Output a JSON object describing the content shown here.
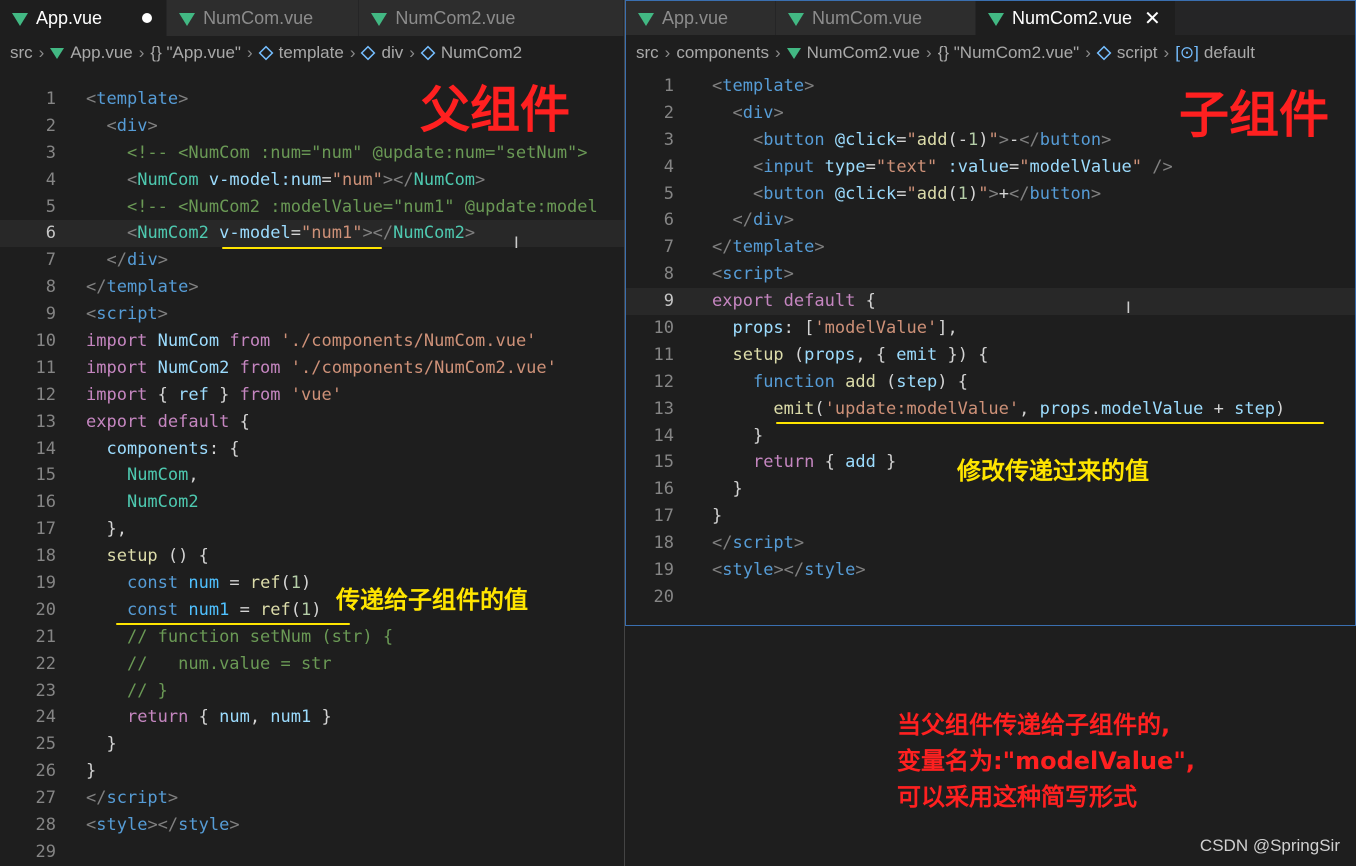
{
  "left": {
    "tabs": [
      {
        "label": "App.vue",
        "active": true,
        "modified": true
      },
      {
        "label": "NumCom.vue",
        "active": false
      },
      {
        "label": "NumCom2.vue",
        "active": false
      }
    ],
    "breadcrumb": [
      "src",
      "App.vue",
      "{} \"App.vue\"",
      "template",
      "div",
      "NumCom2"
    ],
    "heading": "父组件",
    "annotation": "传递给子组件的值",
    "lines": [
      {
        "n": "1",
        "segs": [
          [
            "t-tag",
            "<"
          ],
          [
            "t-name",
            "template"
          ],
          [
            "t-tag",
            ">"
          ]
        ]
      },
      {
        "n": "2",
        "segs": [
          [
            "t-p",
            "  "
          ],
          [
            "t-tag",
            "<"
          ],
          [
            "t-name",
            "div"
          ],
          [
            "t-tag",
            ">"
          ]
        ]
      },
      {
        "n": "3",
        "segs": [
          [
            "t-p",
            "    "
          ],
          [
            "t-cmt",
            "<!-- <NumCom :num=\"num\" @update:num=\"setNum\">"
          ]
        ]
      },
      {
        "n": "4",
        "segs": [
          [
            "t-p",
            "    "
          ],
          [
            "t-tag",
            "<"
          ],
          [
            "t-comp",
            "NumCom"
          ],
          [
            "t-p",
            " "
          ],
          [
            "t-attr",
            "v-model:num"
          ],
          [
            "t-p",
            "="
          ],
          [
            "t-str",
            "\"num\""
          ],
          [
            "t-tag",
            "></"
          ],
          [
            "t-comp",
            "NumCom"
          ],
          [
            "t-tag",
            ">"
          ]
        ]
      },
      {
        "n": "5",
        "segs": [
          [
            "t-p",
            "    "
          ],
          [
            "t-cmt",
            "<!-- <NumCom2 :modelValue=\"num1\" @update:model"
          ]
        ]
      },
      {
        "n": "6",
        "cur": true,
        "segs": [
          [
            "t-p",
            "    "
          ],
          [
            "t-tag",
            "<"
          ],
          [
            "t-comp",
            "NumCom2"
          ],
          [
            "t-p",
            " "
          ],
          [
            "t-attr",
            "v-model"
          ],
          [
            "t-p",
            "="
          ],
          [
            "t-str",
            "\"num1\""
          ],
          [
            "t-tag",
            "></"
          ],
          [
            "t-comp",
            "NumCom2"
          ],
          [
            "t-tag",
            ">"
          ]
        ]
      },
      {
        "n": "7",
        "segs": [
          [
            "t-p",
            "  "
          ],
          [
            "t-tag",
            "</"
          ],
          [
            "t-name",
            "div"
          ],
          [
            "t-tag",
            ">"
          ]
        ]
      },
      {
        "n": "8",
        "segs": [
          [
            "t-tag",
            "</"
          ],
          [
            "t-name",
            "template"
          ],
          [
            "t-tag",
            ">"
          ]
        ]
      },
      {
        "n": "9",
        "segs": [
          [
            "t-tag",
            "<"
          ],
          [
            "t-name",
            "script"
          ],
          [
            "t-tag",
            ">"
          ]
        ]
      },
      {
        "n": "10",
        "segs": [
          [
            "t-kw",
            "import"
          ],
          [
            "t-p",
            " "
          ],
          [
            "t-var",
            "NumCom"
          ],
          [
            "t-p",
            " "
          ],
          [
            "t-kw",
            "from"
          ],
          [
            "t-p",
            " "
          ],
          [
            "t-str",
            "'./components/NumCom.vue'"
          ]
        ]
      },
      {
        "n": "11",
        "segs": [
          [
            "t-kw",
            "import"
          ],
          [
            "t-p",
            " "
          ],
          [
            "t-var",
            "NumCom2"
          ],
          [
            "t-p",
            " "
          ],
          [
            "t-kw",
            "from"
          ],
          [
            "t-p",
            " "
          ],
          [
            "t-str",
            "'./components/NumCom2.vue'"
          ]
        ]
      },
      {
        "n": "12",
        "segs": [
          [
            "t-kw",
            "import"
          ],
          [
            "t-p",
            " { "
          ],
          [
            "t-var",
            "ref"
          ],
          [
            "t-p",
            " } "
          ],
          [
            "t-kw",
            "from"
          ],
          [
            "t-p",
            " "
          ],
          [
            "t-str",
            "'vue'"
          ]
        ]
      },
      {
        "n": "13",
        "segs": [
          [
            "t-kw",
            "export"
          ],
          [
            "t-p",
            " "
          ],
          [
            "t-kw",
            "default"
          ],
          [
            "t-p",
            " {"
          ]
        ]
      },
      {
        "n": "14",
        "segs": [
          [
            "t-p",
            "  "
          ],
          [
            "t-var",
            "components"
          ],
          [
            "t-p",
            ": {"
          ]
        ]
      },
      {
        "n": "15",
        "segs": [
          [
            "t-p",
            "    "
          ],
          [
            "t-comp",
            "NumCom"
          ],
          [
            "t-p",
            ","
          ]
        ]
      },
      {
        "n": "16",
        "segs": [
          [
            "t-p",
            "    "
          ],
          [
            "t-comp",
            "NumCom2"
          ]
        ]
      },
      {
        "n": "17",
        "segs": [
          [
            "t-p",
            "  },"
          ]
        ]
      },
      {
        "n": "18",
        "segs": [
          [
            "t-p",
            "  "
          ],
          [
            "t-fn",
            "setup"
          ],
          [
            "t-p",
            " () {"
          ]
        ]
      },
      {
        "n": "19",
        "segs": [
          [
            "t-p",
            "    "
          ],
          [
            "t-kw2",
            "const"
          ],
          [
            "t-p",
            " "
          ],
          [
            "t-const",
            "num"
          ],
          [
            "t-p",
            " = "
          ],
          [
            "t-fn",
            "ref"
          ],
          [
            "t-p",
            "("
          ],
          [
            "t-num",
            "1"
          ],
          [
            "t-p",
            ")"
          ]
        ]
      },
      {
        "n": "20",
        "segs": [
          [
            "t-p",
            "    "
          ],
          [
            "t-kw2",
            "const"
          ],
          [
            "t-p",
            " "
          ],
          [
            "t-const",
            "num1"
          ],
          [
            "t-p",
            " = "
          ],
          [
            "t-fn",
            "ref"
          ],
          [
            "t-p",
            "("
          ],
          [
            "t-num",
            "1"
          ],
          [
            "t-p",
            ")"
          ]
        ]
      },
      {
        "n": "21",
        "segs": [
          [
            "t-p",
            "    "
          ],
          [
            "t-cmt",
            "// function setNum (str) {"
          ]
        ]
      },
      {
        "n": "22",
        "segs": [
          [
            "t-p",
            "    "
          ],
          [
            "t-cmt",
            "//   num.value = str"
          ]
        ]
      },
      {
        "n": "23",
        "segs": [
          [
            "t-p",
            "    "
          ],
          [
            "t-cmt",
            "// }"
          ]
        ]
      },
      {
        "n": "24",
        "segs": [
          [
            "t-p",
            "    "
          ],
          [
            "t-kw",
            "return"
          ],
          [
            "t-p",
            " { "
          ],
          [
            "t-var",
            "num"
          ],
          [
            "t-p",
            ", "
          ],
          [
            "t-var",
            "num1"
          ],
          [
            "t-p",
            " }"
          ]
        ]
      },
      {
        "n": "25",
        "segs": [
          [
            "t-p",
            "  }"
          ]
        ]
      },
      {
        "n": "26",
        "segs": [
          [
            "t-p",
            "}"
          ]
        ]
      },
      {
        "n": "27",
        "segs": [
          [
            "t-tag",
            "</"
          ],
          [
            "t-name",
            "script"
          ],
          [
            "t-tag",
            ">"
          ]
        ]
      },
      {
        "n": "28",
        "segs": [
          [
            "t-tag",
            "<"
          ],
          [
            "t-name",
            "style"
          ],
          [
            "t-tag",
            "></"
          ],
          [
            "t-name",
            "style"
          ],
          [
            "t-tag",
            ">"
          ]
        ]
      },
      {
        "n": "29",
        "segs": []
      }
    ]
  },
  "right": {
    "tabs": [
      {
        "label": "App.vue",
        "active": false
      },
      {
        "label": "NumCom.vue",
        "active": false
      },
      {
        "label": "NumCom2.vue",
        "active": true,
        "closable": true
      }
    ],
    "breadcrumb": [
      "src",
      "components",
      "NumCom2.vue",
      "{} \"NumCom2.vue\"",
      "script",
      "default"
    ],
    "heading": "子组件",
    "annotation": "修改传递过来的值",
    "lines": [
      {
        "n": "1",
        "segs": [
          [
            "t-tag",
            "<"
          ],
          [
            "t-name",
            "template"
          ],
          [
            "t-tag",
            ">"
          ]
        ]
      },
      {
        "n": "2",
        "segs": [
          [
            "t-p",
            "  "
          ],
          [
            "t-tag",
            "<"
          ],
          [
            "t-name",
            "div"
          ],
          [
            "t-tag",
            ">"
          ]
        ]
      },
      {
        "n": "3",
        "segs": [
          [
            "t-p",
            "    "
          ],
          [
            "t-tag",
            "<"
          ],
          [
            "t-name",
            "button"
          ],
          [
            "t-p",
            " "
          ],
          [
            "t-attr",
            "@click"
          ],
          [
            "t-p",
            "="
          ],
          [
            "t-str",
            "\""
          ],
          [
            "t-fn",
            "add"
          ],
          [
            "t-p",
            "(-"
          ],
          [
            "t-num",
            "1"
          ],
          [
            "t-p",
            ")"
          ],
          [
            "t-str",
            "\""
          ],
          [
            "t-tag",
            ">"
          ],
          [
            "t-p",
            "-"
          ],
          [
            "t-tag",
            "</"
          ],
          [
            "t-name",
            "button"
          ],
          [
            "t-tag",
            ">"
          ]
        ]
      },
      {
        "n": "4",
        "segs": [
          [
            "t-p",
            "    "
          ],
          [
            "t-tag",
            "<"
          ],
          [
            "t-name",
            "input"
          ],
          [
            "t-p",
            " "
          ],
          [
            "t-attr",
            "type"
          ],
          [
            "t-p",
            "="
          ],
          [
            "t-str",
            "\"text\""
          ],
          [
            "t-p",
            " "
          ],
          [
            "t-attr",
            ":value"
          ],
          [
            "t-p",
            "="
          ],
          [
            "t-str",
            "\""
          ],
          [
            "t-var",
            "modelValue"
          ],
          [
            "t-str",
            "\""
          ],
          [
            "t-p",
            " "
          ],
          [
            "t-tag",
            "/>"
          ]
        ]
      },
      {
        "n": "5",
        "segs": [
          [
            "t-p",
            "    "
          ],
          [
            "t-tag",
            "<"
          ],
          [
            "t-name",
            "button"
          ],
          [
            "t-p",
            " "
          ],
          [
            "t-attr",
            "@click"
          ],
          [
            "t-p",
            "="
          ],
          [
            "t-str",
            "\""
          ],
          [
            "t-fn",
            "add"
          ],
          [
            "t-p",
            "("
          ],
          [
            "t-num",
            "1"
          ],
          [
            "t-p",
            ")"
          ],
          [
            "t-str",
            "\""
          ],
          [
            "t-tag",
            ">"
          ],
          [
            "t-p",
            "+"
          ],
          [
            "t-tag",
            "</"
          ],
          [
            "t-name",
            "button"
          ],
          [
            "t-tag",
            ">"
          ]
        ]
      },
      {
        "n": "6",
        "segs": [
          [
            "t-p",
            "  "
          ],
          [
            "t-tag",
            "</"
          ],
          [
            "t-name",
            "div"
          ],
          [
            "t-tag",
            ">"
          ]
        ]
      },
      {
        "n": "7",
        "segs": [
          [
            "t-tag",
            "</"
          ],
          [
            "t-name",
            "template"
          ],
          [
            "t-tag",
            ">"
          ]
        ]
      },
      {
        "n": "8",
        "segs": [
          [
            "t-tag",
            "<"
          ],
          [
            "t-name",
            "script"
          ],
          [
            "t-tag",
            ">"
          ]
        ]
      },
      {
        "n": "9",
        "cur": true,
        "segs": [
          [
            "t-kw",
            "export"
          ],
          [
            "t-p",
            " "
          ],
          [
            "t-kw",
            "default"
          ],
          [
            "t-p",
            " {"
          ]
        ]
      },
      {
        "n": "10",
        "segs": [
          [
            "t-p",
            "  "
          ],
          [
            "t-var",
            "props"
          ],
          [
            "t-p",
            ": ["
          ],
          [
            "t-str",
            "'modelValue'"
          ],
          [
            "t-p",
            "],"
          ]
        ]
      },
      {
        "n": "11",
        "segs": [
          [
            "t-p",
            "  "
          ],
          [
            "t-fn",
            "setup"
          ],
          [
            "t-p",
            " ("
          ],
          [
            "t-var",
            "props"
          ],
          [
            "t-p",
            ", { "
          ],
          [
            "t-var",
            "emit"
          ],
          [
            "t-p",
            " }) {"
          ]
        ]
      },
      {
        "n": "12",
        "segs": [
          [
            "t-p",
            "    "
          ],
          [
            "t-kw2",
            "function"
          ],
          [
            "t-p",
            " "
          ],
          [
            "t-fn",
            "add"
          ],
          [
            "t-p",
            " ("
          ],
          [
            "t-var",
            "step"
          ],
          [
            "t-p",
            ") {"
          ]
        ]
      },
      {
        "n": "13",
        "segs": [
          [
            "t-p",
            "      "
          ],
          [
            "t-fn",
            "emit"
          ],
          [
            "t-p",
            "("
          ],
          [
            "t-str",
            "'update:modelValue'"
          ],
          [
            "t-p",
            ", "
          ],
          [
            "t-var",
            "props"
          ],
          [
            "t-p",
            "."
          ],
          [
            "t-var",
            "modelValue"
          ],
          [
            "t-p",
            " + "
          ],
          [
            "t-var",
            "step"
          ],
          [
            "t-p",
            ")"
          ]
        ]
      },
      {
        "n": "14",
        "segs": [
          [
            "t-p",
            "    }"
          ]
        ]
      },
      {
        "n": "15",
        "segs": [
          [
            "t-p",
            "    "
          ],
          [
            "t-kw",
            "return"
          ],
          [
            "t-p",
            " { "
          ],
          [
            "t-var",
            "add"
          ],
          [
            "t-p",
            " }"
          ]
        ]
      },
      {
        "n": "16",
        "segs": [
          [
            "t-p",
            "  }"
          ]
        ]
      },
      {
        "n": "17",
        "segs": [
          [
            "t-p",
            "}"
          ]
        ]
      },
      {
        "n": "18",
        "segs": [
          [
            "t-tag",
            "</"
          ],
          [
            "t-name",
            "script"
          ],
          [
            "t-tag",
            ">"
          ]
        ]
      },
      {
        "n": "19",
        "segs": [
          [
            "t-tag",
            "<"
          ],
          [
            "t-name",
            "style"
          ],
          [
            "t-tag",
            "></"
          ],
          [
            "t-name",
            "style"
          ],
          [
            "t-tag",
            ">"
          ]
        ]
      },
      {
        "n": "20",
        "segs": []
      }
    ]
  },
  "note": {
    "lines": [
      "当父组件传递给子组件的,",
      "变量名为:\"modelValue\",",
      "可以采用这种简写形式"
    ]
  },
  "watermark": "CSDN @SpringSir",
  "colors": {
    "annotation_red": "#ff2020",
    "annotation_yellow": "#ffe500",
    "vue_green": "#42b883"
  }
}
